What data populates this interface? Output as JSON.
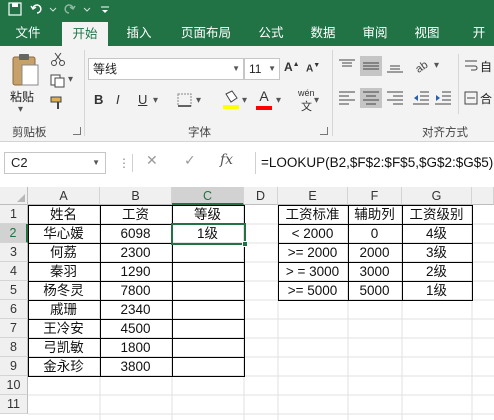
{
  "ribbon_tabs": [
    "文件",
    "开始",
    "插入",
    "页面布局",
    "公式",
    "数据",
    "审阅",
    "视图",
    "开"
  ],
  "active_tab": "开始",
  "clipboard": {
    "paste_label": "粘贴",
    "group_label": "剪贴板"
  },
  "font": {
    "name": "等线",
    "size": "11",
    "group_label": "字体",
    "bold": "B",
    "italic": "I",
    "underline": "U",
    "phonetic": "wén"
  },
  "alignment": {
    "group_label": "对齐方式",
    "wrap_label": "自",
    "merge_label": "合"
  },
  "formula_bar": {
    "name_box": "C2",
    "cancel": "✕",
    "enter": "✓",
    "fx": "fx",
    "formula": "=LOOKUP(B2,$F$2:$F$5,$G$2:$G$5)"
  },
  "columns": [
    "A",
    "B",
    "C",
    "D",
    "E",
    "F",
    "G"
  ],
  "rows": [
    "1",
    "2",
    "3",
    "4",
    "5",
    "6",
    "7",
    "8",
    "9",
    "10",
    "11"
  ],
  "table1": {
    "headers": [
      "姓名",
      "工资",
      "等级"
    ],
    "rows": [
      [
        "华心媛",
        "6098",
        "1级"
      ],
      [
        "何荔",
        "2300",
        ""
      ],
      [
        "秦羽",
        "1290",
        ""
      ],
      [
        "杨冬灵",
        "7800",
        ""
      ],
      [
        "戚珊",
        "2340",
        ""
      ],
      [
        "王冷安",
        "4500",
        ""
      ],
      [
        "弓凯敏",
        "1800",
        ""
      ],
      [
        "金永珍",
        "3800",
        ""
      ]
    ]
  },
  "table2": {
    "headers": [
      "工资标准",
      "辅助列",
      "工资级别"
    ],
    "rows": [
      [
        "< 2000",
        "0",
        "4级"
      ],
      [
        ">= 2000",
        "2000",
        "3级"
      ],
      [
        "> = 3000",
        "3000",
        "2级"
      ],
      [
        ">= 5000",
        "5000",
        "1级"
      ]
    ]
  },
  "colors": {
    "brand": "#217346",
    "ribbon": "#f3f3f3",
    "highlight_yellow": "#ffff00",
    "font_red": "#ff0000"
  }
}
